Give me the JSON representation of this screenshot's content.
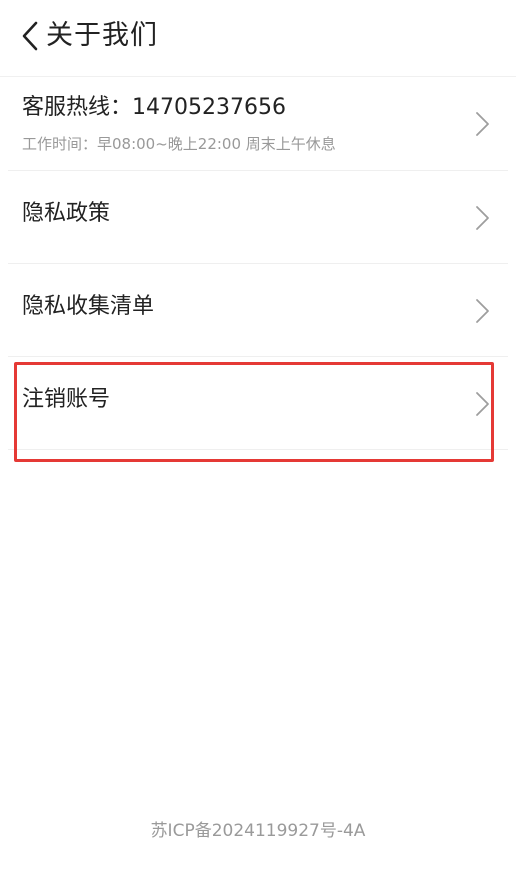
{
  "header": {
    "title": "关于我们",
    "back_icon": "chevron-left-icon"
  },
  "list": {
    "items": [
      {
        "label": "客服热线：14705237656",
        "sub": "工作时间：早08:00~晚上22:00 周末上午休息"
      },
      {
        "label": "隐私政策"
      },
      {
        "label": "隐私收集清单"
      },
      {
        "label": "注销账号"
      }
    ],
    "chevron_icon": "chevron-right-icon"
  },
  "highlight": {
    "color": "#e53935"
  },
  "footer": {
    "icp": "苏ICP备2024119927号-4A"
  }
}
